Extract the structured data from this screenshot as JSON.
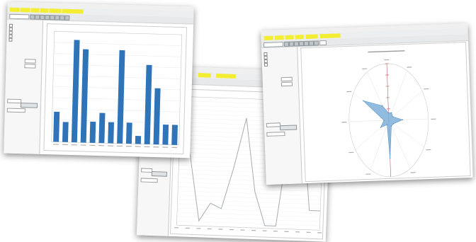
{
  "windows": {
    "left": {
      "menu": [
        "",
        "",
        "",
        "",
        "",
        ""
      ],
      "plot_title": "",
      "chart_data": {
        "type": "bar",
        "categories": [],
        "values": [
          30,
          20,
          102,
          93,
          21,
          30,
          21,
          93,
          21,
          8,
          79,
          56,
          20,
          20
        ],
        "ylim": [
          0,
          110
        ],
        "color": "#2f74b9"
      }
    },
    "middle": {
      "menu": [
        "",
        ""
      ],
      "plot_title": "",
      "chart_data": {
        "type": "line",
        "values": [
          96,
          55,
          4,
          18,
          14,
          46,
          85,
          28,
          2,
          2,
          76,
          95,
          15,
          15
        ],
        "ylim": [
          0,
          100
        ],
        "color": "#a7acb0"
      }
    },
    "right": {
      "menu": [
        "",
        "",
        "",
        "",
        "",
        ""
      ],
      "plot_title": "",
      "chart_data": {
        "type": "radar",
        "axes": 12,
        "values": [
          0.13,
          0.15,
          0.12,
          0.35,
          0.13,
          0.12,
          0.67,
          0.09,
          0.24,
          0.12,
          0.72,
          0.3
        ],
        "fill": "#7fb0d9",
        "stroke": "#5c95c5"
      }
    }
  }
}
